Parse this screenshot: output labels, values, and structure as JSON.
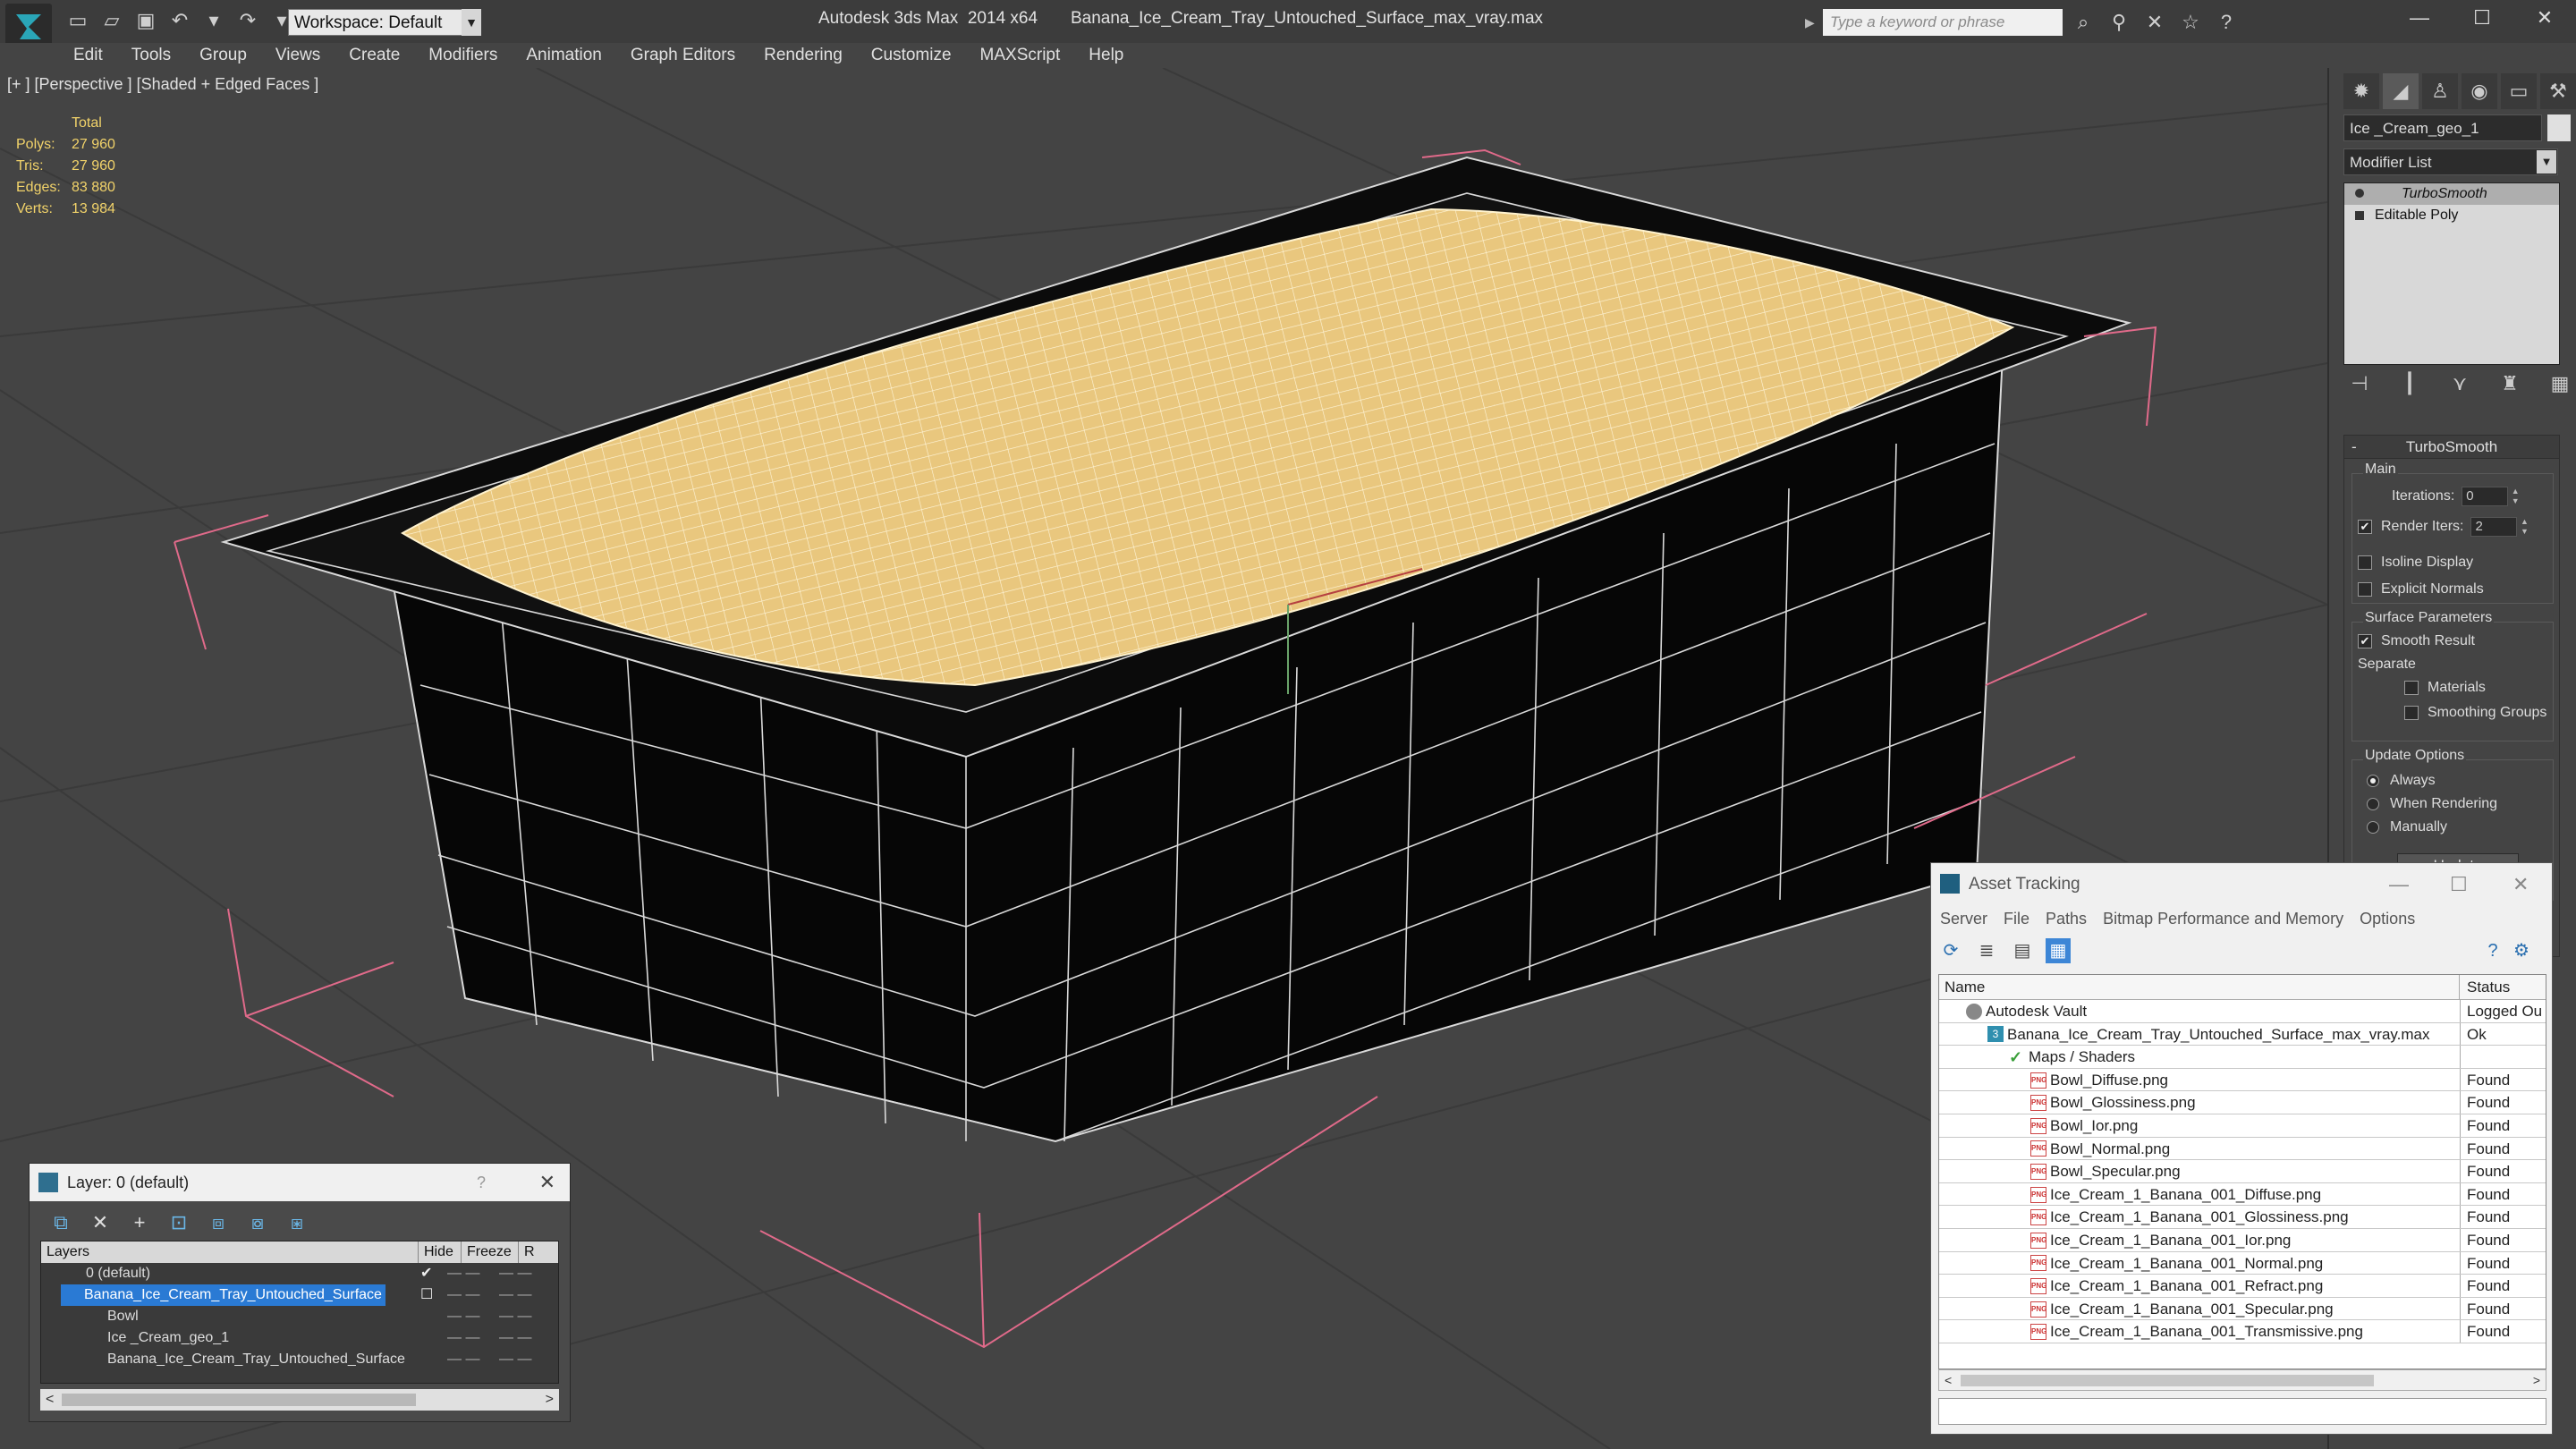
{
  "app": {
    "workspace": "Workspace: Default",
    "window_title": "Autodesk 3ds Max  2014 x64       Banana_Ice_Cream_Tray_Untouched_Surface_max_vray.max",
    "search_placeholder": "Type a keyword or phrase"
  },
  "menu": [
    "Edit",
    "Tools",
    "Group",
    "Views",
    "Create",
    "Modifiers",
    "Animation",
    "Graph Editors",
    "Rendering",
    "Customize",
    "MAXScript",
    "Help"
  ],
  "viewport": {
    "label": "[+ ] [Perspective ] [Shaded + Edged Faces ]",
    "stats": {
      "header": "Total",
      "rows": [
        {
          "label": "Polys:",
          "value": "27 960"
        },
        {
          "label": "Tris:",
          "value": "27 960"
        },
        {
          "label": "Edges:",
          "value": "83 880"
        },
        {
          "label": "Verts:",
          "value": "13 984"
        }
      ]
    }
  },
  "command_panel": {
    "object_name": "Ice _Cream_geo_1",
    "modifier_list": "Modifier List",
    "stack": [
      "TurboSmooth",
      "Editable Poly"
    ],
    "turbosmooth": {
      "title": "TurboSmooth",
      "main_label": "Main",
      "iterations_label": "Iterations:",
      "iterations_value": "0",
      "render_iters_label": "Render Iters:",
      "render_iters_value": "2",
      "isoline_label": "Isoline Display",
      "explicit_label": "Explicit Normals",
      "surface_label": "Surface Parameters",
      "smooth_result_label": "Smooth Result",
      "separate_label": "Separate",
      "materials_label": "Materials",
      "smoothing_groups_label": "Smoothing Groups",
      "update_options_label": "Update Options",
      "always_label": "Always",
      "when_rendering_label": "When Rendering",
      "manually_label": "Manually",
      "update_button": "Update"
    }
  },
  "layer_dialog": {
    "title": "Layer: 0 (default)",
    "help": "?",
    "columns": [
      "Layers",
      "Hide",
      "Freeze",
      "R"
    ],
    "rows": [
      {
        "name": "0 (default)"
      },
      {
        "name": "Banana_Ice_Cream_Tray_Untouched_Surface"
      },
      {
        "name": "Bowl"
      },
      {
        "name": "Ice _Cream_geo_1"
      },
      {
        "name": "Banana_Ice_Cream_Tray_Untouched_Surface"
      }
    ]
  },
  "asset_tracking": {
    "title": "Asset Tracking",
    "menu": [
      "Server",
      "File",
      "Paths",
      "Bitmap Performance and Memory",
      "Options"
    ],
    "columns": [
      "Name",
      "Status"
    ],
    "rows": [
      {
        "name": "Autodesk Vault",
        "status": "Logged Ou",
        "icon": "vault-icon"
      },
      {
        "name": "Banana_Ice_Cream_Tray_Untouched_Surface_max_vray.max",
        "status": "Ok",
        "icon": "max-file-icon"
      },
      {
        "name": "Maps / Shaders",
        "status": "",
        "icon": "maps-icon"
      },
      {
        "name": "Bowl_Diffuse.png",
        "status": "Found",
        "icon": "png-icon"
      },
      {
        "name": "Bowl_Glossiness.png",
        "status": "Found",
        "icon": "png-icon"
      },
      {
        "name": "Bowl_Ior.png",
        "status": "Found",
        "icon": "png-icon"
      },
      {
        "name": "Bowl_Normal.png",
        "status": "Found",
        "icon": "png-icon"
      },
      {
        "name": "Bowl_Specular.png",
        "status": "Found",
        "icon": "png-icon"
      },
      {
        "name": "Ice_Cream_1_Banana_001_Diffuse.png",
        "status": "Found",
        "icon": "png-icon"
      },
      {
        "name": "Ice_Cream_1_Banana_001_Glossiness.png",
        "status": "Found",
        "icon": "png-icon"
      },
      {
        "name": "Ice_Cream_1_Banana_001_Ior.png",
        "status": "Found",
        "icon": "png-icon"
      },
      {
        "name": "Ice_Cream_1_Banana_001_Normal.png",
        "status": "Found",
        "icon": "png-icon"
      },
      {
        "name": "Ice_Cream_1_Banana_001_Refract.png",
        "status": "Found",
        "icon": "png-icon"
      },
      {
        "name": "Ice_Cream_1_Banana_001_Specular.png",
        "status": "Found",
        "icon": "png-icon"
      },
      {
        "name": "Ice_Cream_1_Banana_001_Transmissive.png",
        "status": "Found",
        "icon": "png-icon"
      }
    ]
  },
  "colors": {
    "viewport_bg": "#444444",
    "ice_cream": "#e9c77e",
    "selection_bracket": "#e06a8a",
    "stats_text": "#f2d36a",
    "selection_blue": "#2a7ad4"
  }
}
